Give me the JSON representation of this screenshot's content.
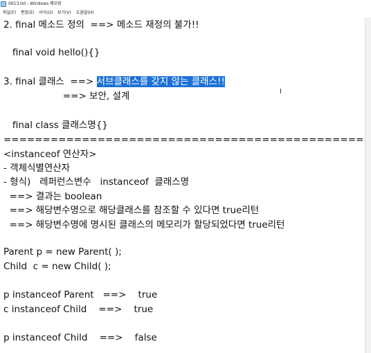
{
  "window": {
    "title": "0613.txt - Windows 메모장"
  },
  "menu": {
    "file": "파일(F)",
    "edit": "편집(E)",
    "format": "서식(O)",
    "view": "보기(V)",
    "help": "도움말(H)"
  },
  "content": {
    "lines": [
      "2. final 메소드 정의  ==> 메소드 재정의 불가!!",
      "",
      "   final void hello(){}",
      "",
      "3. final 클래스  ==> ",
      "                    ==> 보안, 설계",
      "",
      "   final class 클래스명{}",
      "==================================================",
      "<instanceof 연산자>",
      "- 객체식별연산자",
      "- 형식)   레퍼런스변수   instanceof  클래스명",
      "  ==> 결과는 boolean",
      "  ==> 해당변수명으로 해당클래스를 참조할 수 있다면 true리턴",
      "  ==> 해당변수명에 명시된 클래스의 메모리가 할당되었다면 true리턴",
      "",
      "Parent p = new Parent( );",
      "Child  c = new Child( );",
      "",
      "p instanceof Parent   ==>    true",
      "c instanceof Child    ==>    true",
      "",
      "p instanceof Child    ==>    false"
    ],
    "selection": "서브클래스를 갖지 않는 클래스!!"
  }
}
